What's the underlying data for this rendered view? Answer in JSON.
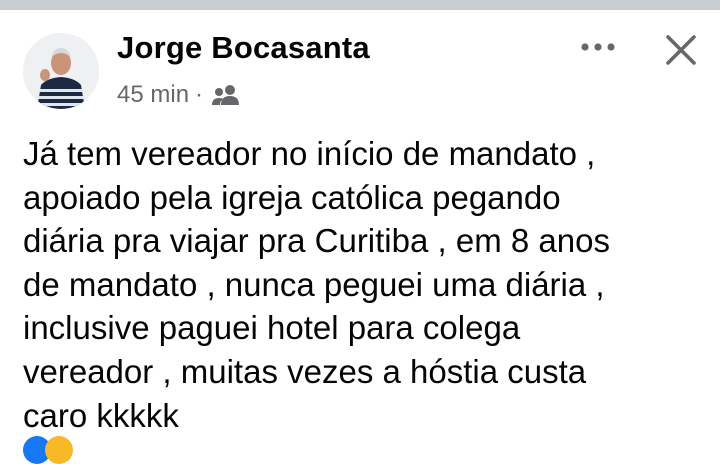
{
  "post": {
    "author": "Jorge Bocasanta",
    "timestamp": "45 min",
    "separator": "·",
    "audience_icon": "friends-icon",
    "more_icon": "more-horizontal-icon",
    "close_icon": "close-icon",
    "text": "Já tem vereador no início de mandato ,\napoiado pela igreja católica pegando\ndiária pra viajar pra Curitiba , em 8 anos\nde mandato , nunca peguei uma diária ,\ninclusive paguei hotel para colega\nvereador , muitas vezes a hóstia custa\ncaro kkkkk"
  },
  "colors": {
    "text_primary": "#050505",
    "text_secondary": "#65676b",
    "divider": "#c9ccd1"
  }
}
